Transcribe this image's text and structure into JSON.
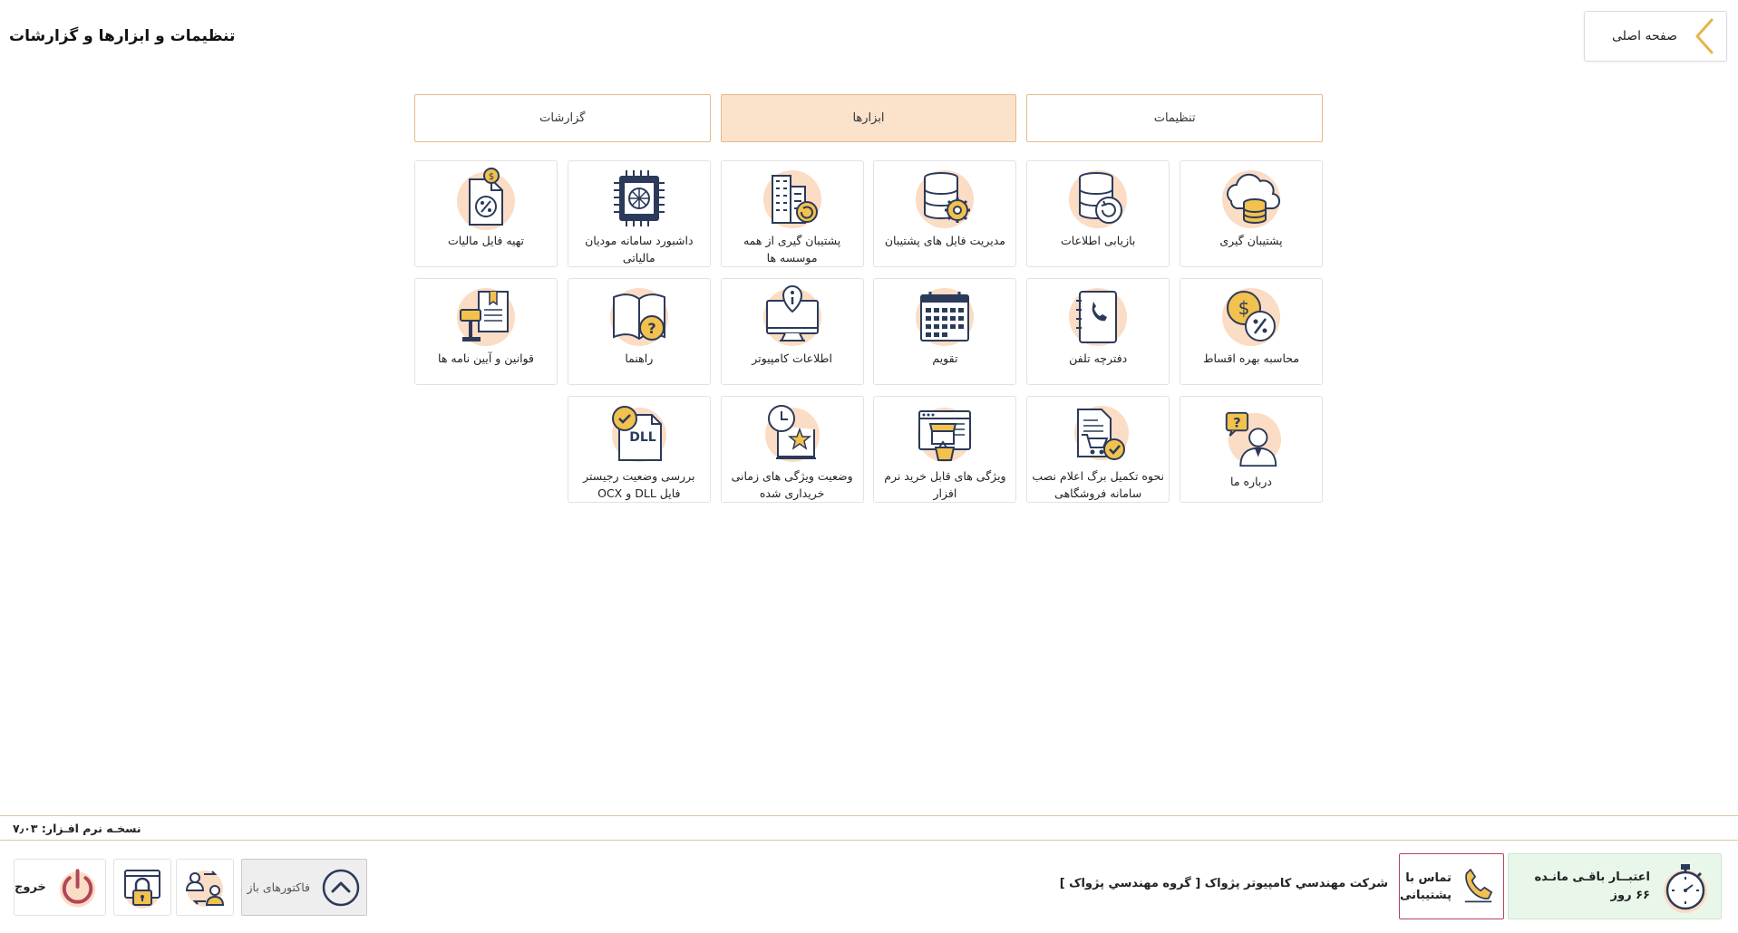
{
  "header": {
    "home_label": "صفحه اصلی",
    "title": "تنظیمات و ابزارها و گزارشات"
  },
  "tabs": [
    {
      "label": "تنظیمات",
      "active": false
    },
    {
      "label": "ابزارها",
      "active": true
    },
    {
      "label": "گزارشات",
      "active": false
    }
  ],
  "tools": [
    {
      "label": "پشتیبان گیری",
      "icon": "cloud-database-icon"
    },
    {
      "label": "بازیابی اطلاعات",
      "icon": "database-restore-icon"
    },
    {
      "label": "مدیریت فایل های پشتیبان",
      "icon": "database-gear-icon"
    },
    {
      "label": "پشتیبان گیری از همه موسسه ها",
      "icon": "buildings-backup-icon"
    },
    {
      "label": "داشبورد سامانه مودیان مالیاتی",
      "icon": "chip-dashboard-icon"
    },
    {
      "label": "تهیه فایل مالیات",
      "icon": "tax-file-icon"
    },
    {
      "label": "محاسبه بهره اقساط",
      "icon": "interest-calculator-icon"
    },
    {
      "label": "دفترچه تلفن",
      "icon": "phonebook-icon"
    },
    {
      "label": "تقویم",
      "icon": "calendar-icon"
    },
    {
      "label": "اطلاعات کامپیوتر",
      "icon": "computer-info-icon"
    },
    {
      "label": "راهنما",
      "icon": "help-book-icon"
    },
    {
      "label": "قوانین و آیین نامه ها",
      "icon": "law-gavel-icon"
    },
    {
      "label": "درباره ما",
      "icon": "about-person-icon"
    },
    {
      "label": "نحوه تکمیل برگ اعلام نصب سامانه فروشگاهی",
      "icon": "cart-document-icon"
    },
    {
      "label": "ویژگی های قابل خرید نرم افزار",
      "icon": "store-basket-icon"
    },
    {
      "label": "وضعیت ویژگی های زمانی خریداری شده",
      "icon": "clock-star-icon"
    },
    {
      "label": "بررسی وضعیت رجیستر فایل DLL و OCX",
      "icon": "dll-check-icon"
    }
  ],
  "footer": {
    "version": "نسخـه نرم افـزار: ۷٫۰۳",
    "credit_line1": "اعتبــار باقـی مانـده",
    "credit_line2": "۶۶ روز",
    "support_line1": "تماس با",
    "support_line2": "پشتیبانی",
    "company": "شرکت مهندسي کامپيوتر پژواک [ گروه مهندسي پژواک ]",
    "open_invoices": "فاکتورهای باز",
    "exit": "خروج"
  },
  "colors": {
    "accent_peach": "#fbe2cb",
    "tab_border": "#e6b98d",
    "icon_navy": "#2b3a5a",
    "icon_gold": "#f2c14e",
    "icon_blob": "#fbdcc4",
    "credit_bg": "#e9f7ea",
    "support_border": "#b2455a",
    "chevron": "#e8b44a"
  }
}
